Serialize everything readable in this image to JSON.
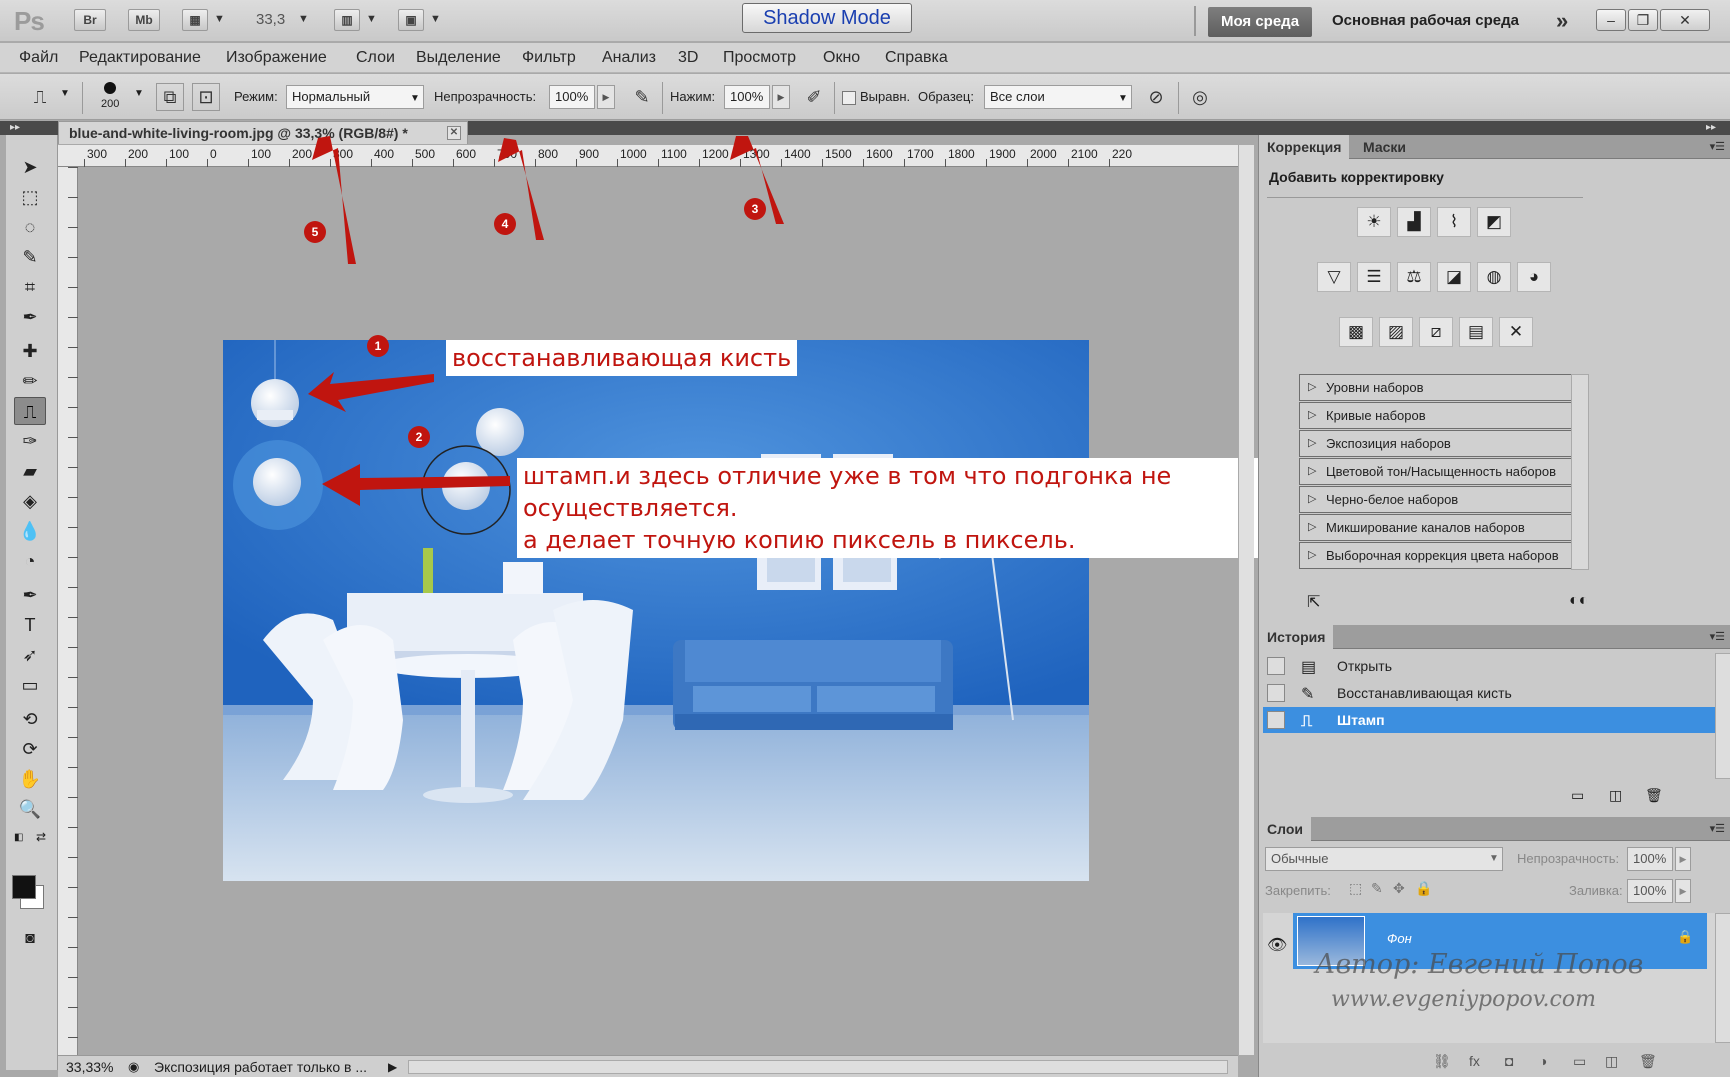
{
  "app": {
    "logo": "Ps",
    "bridge": "Br",
    "minibridge": "Mb",
    "zoom": "33,3",
    "shadow_mode": "Shadow Mode",
    "workspace_active": "Моя среда",
    "workspace_main": "Основная рабочая среда",
    "more": "»"
  },
  "menu": [
    "Файл",
    "Редактирование",
    "Изображение",
    "Слои",
    "Выделение",
    "Фильтр",
    "Анализ",
    "3D",
    "Просмотр",
    "Окно",
    "Справка"
  ],
  "options": {
    "brush_size": "200",
    "mode_label": "Режим:",
    "mode_value": "Нормальный",
    "opacity_label": "Непрозрачность:",
    "opacity_value": "100%",
    "flow_label": "Нажим:",
    "flow_value": "100%",
    "aligned_label": "Выравн.",
    "sample_label": "Образец:",
    "sample_value": "Все слои"
  },
  "document": {
    "tab_title": "blue-and-white-living-room.jpg @ 33,3% (RGB/8#) *",
    "ruler_h": [
      "300",
      "200",
      "100",
      "0",
      "100",
      "200",
      "300",
      "400",
      "500",
      "600",
      "700",
      "800",
      "900",
      "1000",
      "1100",
      "1200",
      "1300",
      "1400",
      "1500",
      "1600",
      "1700",
      "1800",
      "1900",
      "2000",
      "2100",
      "220"
    ]
  },
  "annotations": {
    "label1": "восстанавливающая кисть",
    "label2_line1": "штамп.и здесь отличие уже в том что подгонка не осуществляется.",
    "label2_line2": "а делает точную копию пиксель в пиксель.",
    "n1": "1",
    "n2": "2",
    "n3": "3",
    "n4": "4",
    "n5": "5"
  },
  "status": {
    "zoom": "33,33%",
    "message": "Экспозиция работает только в ..."
  },
  "adjustments": {
    "tab1": "Коррекция",
    "tab2": "Маски",
    "heading": "Добавить корректировку",
    "presets": [
      "Уровни наборов",
      "Кривые наборов",
      "Экспозиция наборов",
      "Цветовой тон/Насыщенность наборов",
      "Черно-белое наборов",
      "Микширование каналов наборов",
      "Выборочная коррекция цвета наборов"
    ]
  },
  "history": {
    "tab": "История",
    "items": [
      "Открыть",
      "Восстанавливающая кисть",
      "Штамп"
    ]
  },
  "layers": {
    "tab": "Слои",
    "blend": "Обычные",
    "opacity_label": "Непрозрачность:",
    "opacity_value": "100%",
    "lock_label": "Закрепить:",
    "fill_label": "Заливка:",
    "fill_value": "100%",
    "layer_name": "Фон",
    "watermark1": "Автор: Евгений Попов",
    "watermark2": "www.evgeniypopov.com"
  },
  "colors": {
    "accent_red": "#c0150f",
    "selection_blue": "#3c8fe0"
  }
}
